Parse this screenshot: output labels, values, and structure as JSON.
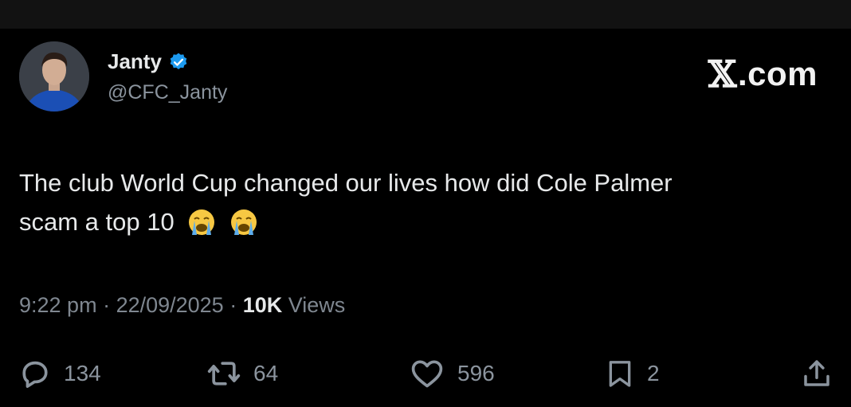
{
  "author": {
    "name": "Janty",
    "handle": "@CFC_Janty",
    "verified_color": "#1d9bf0"
  },
  "brand": {
    "symbol": "𝕏",
    "text": ".com"
  },
  "tweet": {
    "line1": "The club World Cup changed our lives how did Cole Palmer",
    "line2": "scam a top 10",
    "emojis": [
      "loudly-crying-face",
      "loudly-crying-face"
    ]
  },
  "meta": {
    "time": "9:22 pm",
    "separator": " · ",
    "date": "22/09/2025",
    "views_count": "10K",
    "views_label": " Views"
  },
  "actions": {
    "replies": "134",
    "reposts": "64",
    "likes": "596",
    "bookmarks": "2"
  },
  "icons": [
    "verified-badge-icon",
    "reply-icon",
    "repost-icon",
    "like-icon",
    "bookmark-icon",
    "share-icon"
  ]
}
